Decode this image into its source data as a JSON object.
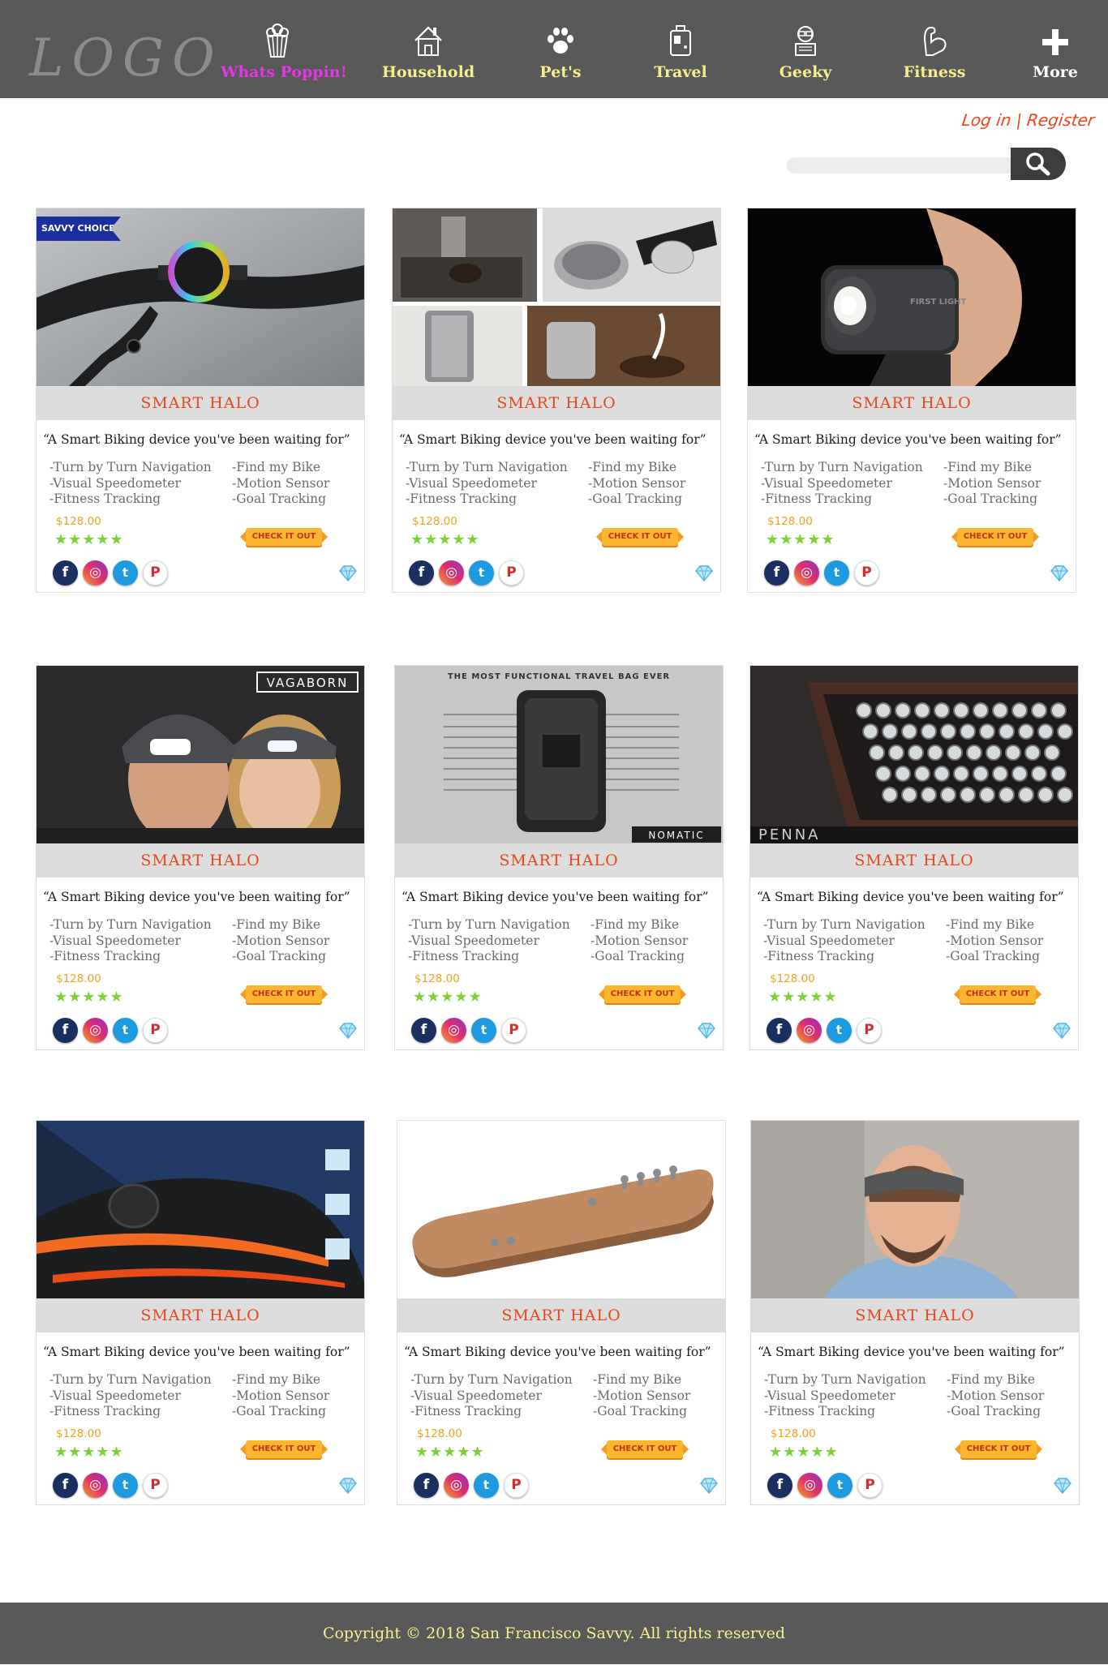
{
  "nav": {
    "logo": "LOGO",
    "items": [
      {
        "label": "Whats Poppin!",
        "icon": "popcorn-icon",
        "active": true
      },
      {
        "label": "Household",
        "icon": "house-icon"
      },
      {
        "label": "Pet's",
        "icon": "paw-icon"
      },
      {
        "label": "Travel",
        "icon": "luggage-icon"
      },
      {
        "label": "Geeky",
        "icon": "geek-icon"
      },
      {
        "label": "Fitness",
        "icon": "flexed-arm-icon"
      },
      {
        "label": "More",
        "icon": "plus-icon"
      }
    ]
  },
  "auth": {
    "login": "Log in",
    "separator": "|",
    "register": "Register"
  },
  "search": {
    "placeholder": "",
    "icon": "search-icon"
  },
  "colors": {
    "nav_bg": "#595959",
    "nav_text": "#f7ee8c",
    "active": "#e437e6",
    "accent": "#e8461b",
    "star": "#7ad233",
    "price": "#f0a21a"
  },
  "badge": "SAVVY CHOICE",
  "products": [
    {
      "image": "bike-handlebar-photo",
      "title": "SMART HALO",
      "tagline": "“A Smart Biking device you've been waiting for”",
      "features_left": [
        "-Turn by Turn Navigation",
        "-Visual Speedometer",
        "-Fitness Tracking"
      ],
      "features_right": [
        "-Find my Bike",
        "-Motion Sensor",
        "-Goal Tracking"
      ],
      "price": "$128.00",
      "rating": 5,
      "cta": "CHECK IT OUT",
      "badge": true
    },
    {
      "image": "coffee-kettle-collage-photo",
      "title": "SMART HALO",
      "tagline": "“A Smart Biking device you've been waiting for”",
      "features_left": [
        "-Turn by Turn Navigation",
        "-Visual Speedometer",
        "-Fitness Tracking"
      ],
      "features_right": [
        "-Find my Bike",
        "-Motion Sensor",
        "-Goal Tracking"
      ],
      "price": "$128.00",
      "rating": 5,
      "cta": "CHECK IT OUT"
    },
    {
      "image": "handheld-flashlight-photo",
      "title": "SMART HALO",
      "tagline": "“A Smart Biking device you've been waiting for”",
      "features_left": [
        "-Turn by Turn Navigation",
        "-Visual Speedometer",
        "-Fitness Tracking"
      ],
      "features_right": [
        "-Find my Bike",
        "-Motion Sensor",
        "-Goal Tracking"
      ],
      "price": "$128.00",
      "rating": 5,
      "cta": "CHECK IT OUT"
    },
    {
      "image": "led-beanie-photo",
      "image_text": "VAGABORN",
      "title": "SMART HALO",
      "tagline": "“A Smart Biking device you've been waiting for”",
      "features_left": [
        "-Turn by Turn Navigation",
        "-Visual Speedometer",
        "-Fitness Tracking"
      ],
      "features_right": [
        "-Find my Bike",
        "-Motion Sensor",
        "-Goal Tracking"
      ],
      "price": "$128.00",
      "rating": 5,
      "cta": "CHECK IT OUT"
    },
    {
      "image": "travel-bag-photo",
      "image_text": "THE MOST FUNCTIONAL TRAVEL BAG EVER",
      "image_brand": "NOMATIC",
      "title": "SMART HALO",
      "tagline": "“A Smart Biking device you've been waiting for”",
      "features_left": [
        "-Turn by Turn Navigation",
        "-Visual Speedometer",
        "-Fitness Tracking"
      ],
      "features_right": [
        "-Find my Bike",
        "-Motion Sensor",
        "-Goal Tracking"
      ],
      "price": "$128.00",
      "rating": 5,
      "cta": "CHECK IT OUT"
    },
    {
      "image": "typewriter-keyboard-photo",
      "image_text": "PENNA",
      "title": "SMART HALO",
      "tagline": "“A Smart Biking device you've been waiting for”",
      "features_left": [
        "-Turn by Turn Navigation",
        "-Visual Speedometer",
        "-Fitness Tracking"
      ],
      "features_right": [
        "-Find my Bike",
        "-Motion Sensor",
        "-Goal Tracking"
      ],
      "price": "$128.00",
      "rating": 5,
      "cta": "CHECK IT OUT"
    },
    {
      "image": "bike-helmet-light-photo",
      "title": "SMART HALO",
      "tagline": "“A Smart Biking device you've been waiting for”",
      "features_left": [
        "-Turn by Turn Navigation",
        "-Visual Speedometer",
        "-Fitness Tracking"
      ],
      "features_right": [
        "-Find my Bike",
        "-Motion Sensor",
        "-Goal Tracking"
      ],
      "price": "$128.00",
      "rating": 5,
      "cta": "CHECK IT OUT"
    },
    {
      "image": "wooden-board-photo",
      "title": "SMART HALO",
      "tagline": "“A Smart Biking device you've been waiting for”",
      "features_left": [
        "-Turn by Turn Navigation",
        "-Visual Speedometer",
        "-Fitness Tracking"
      ],
      "features_right": [
        "-Find my Bike",
        "-Motion Sensor",
        "-Goal Tracking"
      ],
      "price": "$128.00",
      "rating": 5,
      "cta": "CHECK IT OUT"
    },
    {
      "image": "headband-man-photo",
      "title": "SMART HALO",
      "tagline": "“A Smart Biking device you've been waiting for”",
      "features_left": [
        "-Turn by Turn Navigation",
        "-Visual Speedometer",
        "-Fitness Tracking"
      ],
      "features_right": [
        "-Find my Bike",
        "-Motion Sensor",
        "-Goal Tracking"
      ],
      "price": "$128.00",
      "rating": 5,
      "cta": "CHECK IT OUT"
    }
  ],
  "social": [
    {
      "icon": "facebook-icon",
      "glyph": "f"
    },
    {
      "icon": "instagram-icon",
      "glyph": "◎"
    },
    {
      "icon": "twitter-icon",
      "glyph": "t"
    },
    {
      "icon": "pinterest-icon",
      "glyph": "P"
    }
  ],
  "footer": {
    "copyright": "Copyright © 2018 San Francisco Savvy. All rights reserved"
  }
}
